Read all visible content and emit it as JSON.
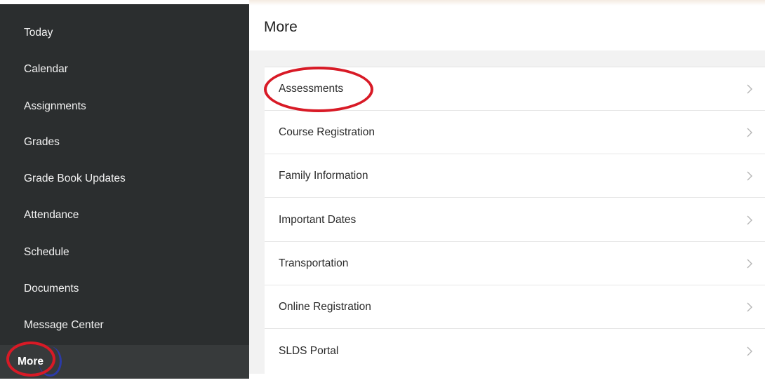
{
  "sidebar": {
    "items": [
      {
        "label": "Today"
      },
      {
        "label": "Calendar"
      },
      {
        "label": "Assignments"
      },
      {
        "label": "Grades"
      },
      {
        "label": "Grade Book Updates"
      },
      {
        "label": "Attendance"
      },
      {
        "label": "Schedule"
      },
      {
        "label": "Documents"
      },
      {
        "label": "Message Center"
      },
      {
        "label": "More",
        "active": true
      }
    ]
  },
  "main": {
    "title": "More",
    "items": [
      {
        "label": "Assessments",
        "icon": "chevron-right-icon"
      },
      {
        "label": "Course Registration",
        "icon": "chevron-right-icon"
      },
      {
        "label": "Family Information",
        "icon": "chevron-right-icon"
      },
      {
        "label": "Important Dates",
        "icon": "chevron-right-icon"
      },
      {
        "label": "Transportation",
        "icon": "chevron-right-icon"
      },
      {
        "label": "Online Registration",
        "icon": "chevron-right-icon"
      },
      {
        "label": "SLDS Portal",
        "icon": "chevron-right-icon"
      }
    ]
  },
  "colors": {
    "sidebar_bg": "#2b2e2f",
    "annotation_red": "#d81a26",
    "annotation_blue": "#2b3aa6",
    "content_bg": "#f2f2f2"
  }
}
